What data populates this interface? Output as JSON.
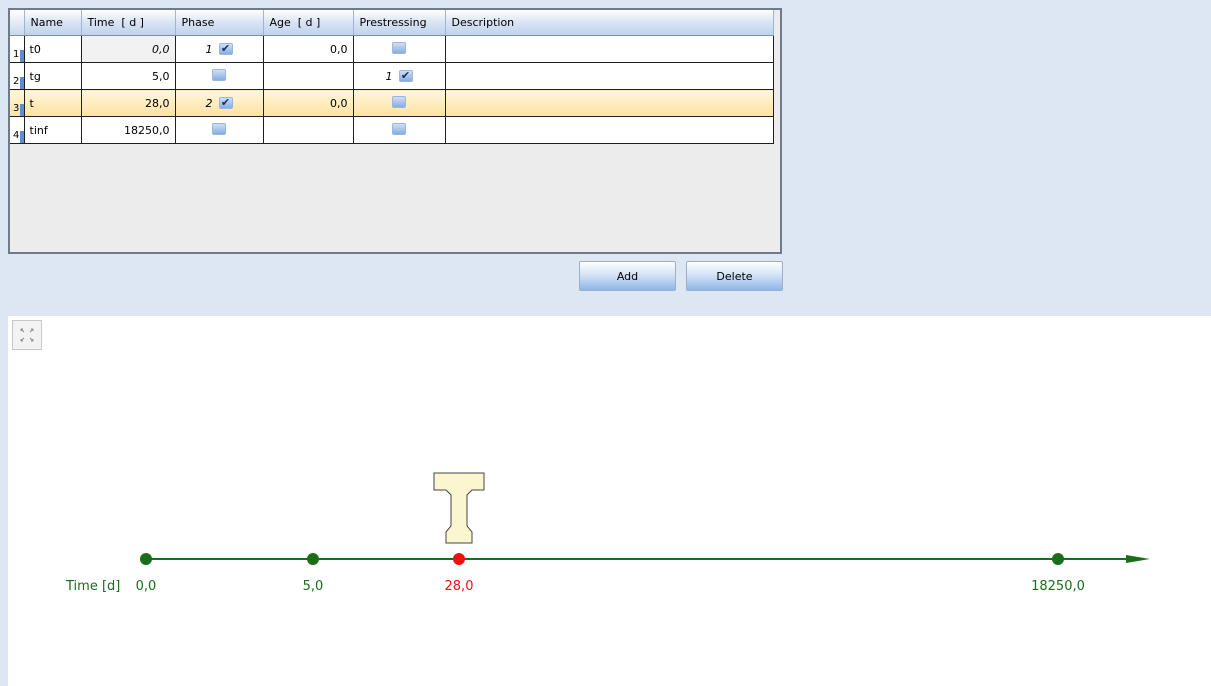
{
  "grid": {
    "headers": [
      "Name",
      "Time  [ d ]",
      "Phase",
      "Age  [ d ]",
      "Prestressing",
      "Description"
    ],
    "rows": [
      {
        "num": "1",
        "name": "t0",
        "time": "0,0",
        "phase_num": "1",
        "phase_checked": true,
        "age": "0,0",
        "prestress_num": "",
        "prestress_checked": false,
        "description": ""
      },
      {
        "num": "2",
        "name": "tg",
        "time": "5,0",
        "phase_num": "",
        "phase_checked": false,
        "age": "",
        "prestress_num": "1",
        "prestress_checked": true,
        "description": ""
      },
      {
        "num": "3",
        "name": "t",
        "time": "28,0",
        "phase_num": "2",
        "phase_checked": true,
        "age": "0,0",
        "prestress_num": "",
        "prestress_checked": false,
        "description": ""
      },
      {
        "num": "4",
        "name": "tinf",
        "time": "18250,0",
        "phase_num": "",
        "phase_checked": false,
        "age": "",
        "prestress_num": "",
        "prestress_checked": false,
        "description": ""
      }
    ],
    "selected_row": "3"
  },
  "buttons": {
    "add_label": "Add",
    "delete_label": "Delete"
  },
  "timeline": {
    "axis_label": "Time [d]",
    "points": [
      {
        "label": "0,0",
        "value": 0.0,
        "color": "#1a6e1a"
      },
      {
        "label": "5,0",
        "value": 5.0,
        "color": "#1a6e1a"
      },
      {
        "label": "28,0",
        "value": 28.0,
        "color": "#ee1111"
      },
      {
        "label": "18250,0",
        "value": 18250.0,
        "color": "#1a6e1a"
      }
    ],
    "marker_icon": "i-beam-section-icon",
    "axis_color": "#1a6e1a",
    "selected_color": "#ee1111"
  },
  "icons": {
    "fit": "fit-to-view-icon",
    "check": "checkmark-icon"
  }
}
